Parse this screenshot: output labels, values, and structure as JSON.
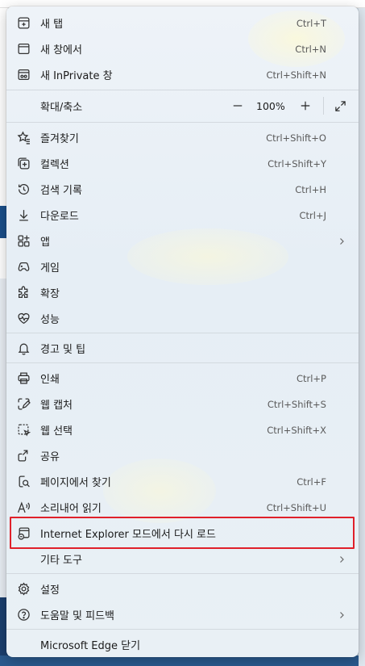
{
  "menu": {
    "items": [
      {
        "label": "새 탭",
        "shortcut": "Ctrl+T",
        "icon": "new-tab-icon"
      },
      {
        "label": "새 창에서",
        "shortcut": "Ctrl+N",
        "icon": "new-window-icon"
      },
      {
        "label": "새 InPrivate 창",
        "shortcut": "Ctrl+Shift+N",
        "icon": "inprivate-icon"
      },
      {
        "label": "확대/축소",
        "icon": "none"
      },
      {
        "label": "즐겨찾기",
        "shortcut": "Ctrl+Shift+O",
        "icon": "favorites-icon"
      },
      {
        "label": "컬렉션",
        "shortcut": "Ctrl+Shift+Y",
        "icon": "collections-icon"
      },
      {
        "label": "검색 기록",
        "shortcut": "Ctrl+H",
        "icon": "history-icon"
      },
      {
        "label": "다운로드",
        "shortcut": "Ctrl+J",
        "icon": "download-icon"
      },
      {
        "label": "앱",
        "icon": "apps-icon"
      },
      {
        "label": "게임",
        "icon": "games-icon"
      },
      {
        "label": "확장",
        "icon": "extensions-icon"
      },
      {
        "label": "성능",
        "icon": "performance-icon"
      },
      {
        "label": "경고 및 팁",
        "icon": "bell-icon"
      },
      {
        "label": "인쇄",
        "shortcut": "Ctrl+P",
        "icon": "print-icon"
      },
      {
        "label": "웹 캡처",
        "shortcut": "Ctrl+Shift+S",
        "icon": "web-capture-icon"
      },
      {
        "label": "웹 선택",
        "shortcut": "Ctrl+Shift+X",
        "icon": "web-select-icon"
      },
      {
        "label": "공유",
        "icon": "share-icon"
      },
      {
        "label": "페이지에서 찾기",
        "shortcut": "Ctrl+F",
        "icon": "find-icon"
      },
      {
        "label": "소리내어 읽기",
        "shortcut": "Ctrl+Shift+U",
        "icon": "read-aloud-icon"
      },
      {
        "label": "Internet Explorer 모드에서 다시 로드",
        "icon": "ie-mode-icon"
      },
      {
        "label": "기타 도구",
        "icon": "none"
      },
      {
        "label": "설정",
        "icon": "settings-icon"
      },
      {
        "label": "도움말 및 피드백",
        "icon": "help-icon"
      },
      {
        "label": "Microsoft Edge 닫기",
        "icon": "none"
      }
    ],
    "zoom": {
      "value": "100%",
      "minus": "—",
      "plus": "+"
    }
  },
  "colors": {
    "highlight": "#e0202a",
    "menu_bg": "#eef3f8"
  }
}
